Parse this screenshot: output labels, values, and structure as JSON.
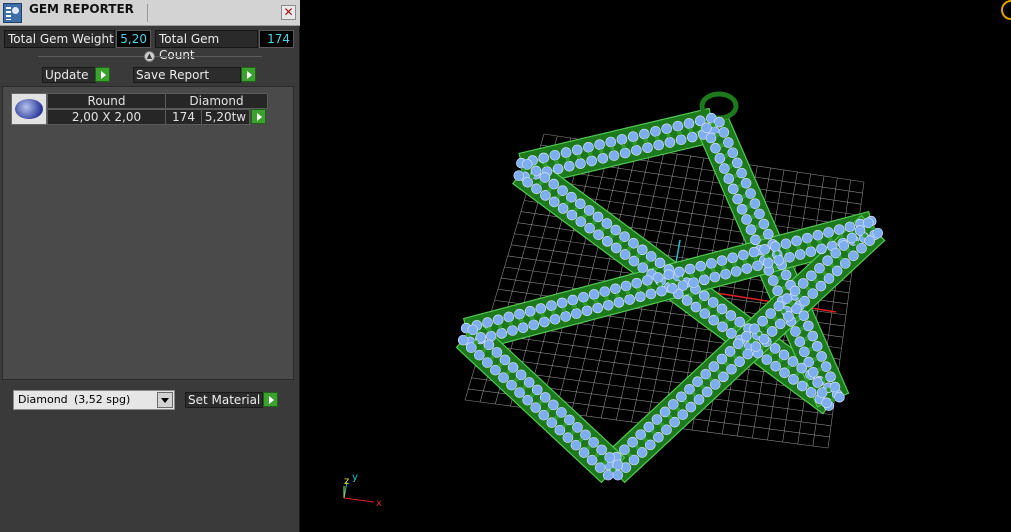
{
  "panel": {
    "title": "GEM REPORTER",
    "close_glyph": "✕",
    "total_gem_weight_label": "Total Gem Weight",
    "total_gem_weight_value": "5,20",
    "total_gem_count_label": "Total Gem Count",
    "total_gem_count_value": "174",
    "update_label": "Update",
    "save_report_label": "Save Report",
    "gem_table": {
      "shape": "Round",
      "size": "2,00 X 2,00",
      "material": "Diamond",
      "count": "174",
      "weight": "5,20tw"
    },
    "material_select": {
      "name": "Diamond",
      "spg": "(3,52 spg)"
    },
    "set_material_label": "Set Material"
  },
  "viewport": {
    "axis_x_label": "x",
    "axis_y_label": "y",
    "axis_z_label": "z",
    "colors": {
      "metal": "#1c7a1c",
      "metal_edge": "#52c852",
      "gem": "#7eaef0",
      "grid": "#b4b4b4",
      "axis_x": "#e02020",
      "axis_y": "#20c0d0"
    }
  }
}
